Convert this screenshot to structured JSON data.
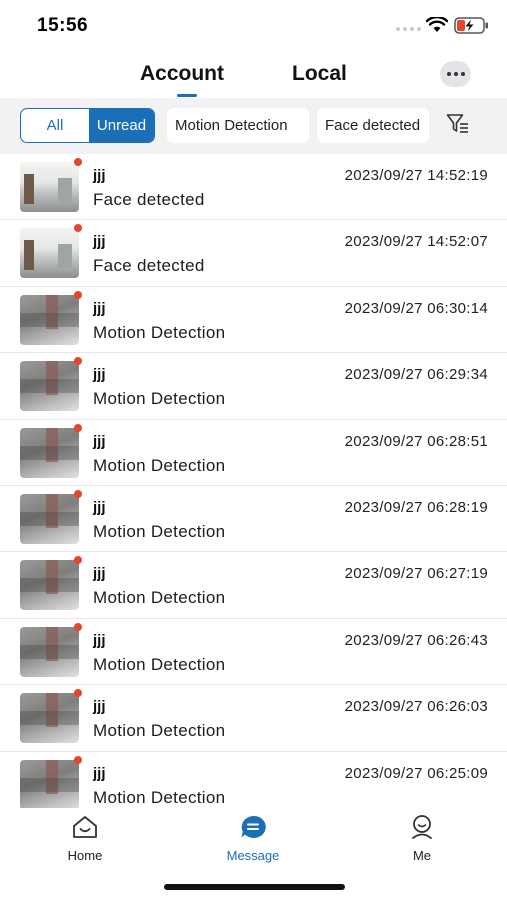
{
  "status_bar": {
    "time": "15:56"
  },
  "header": {
    "tabs": [
      {
        "label": "Account",
        "active": true
      },
      {
        "label": "Local",
        "active": false
      }
    ],
    "more_icon": "ellipsis-icon"
  },
  "filters": {
    "all_label": "All",
    "unread_label": "Unread",
    "selected": "Unread",
    "chips": [
      "Motion Detection",
      "Face detected"
    ],
    "filter_icon": "filter-list-icon"
  },
  "messages": [
    {
      "device": "jjj",
      "type": "Face detected",
      "time": "2023/09/27 14:52:19",
      "thumb": "face",
      "unread": true
    },
    {
      "device": "jjj",
      "type": "Face detected",
      "time": "2023/09/27 14:52:07",
      "thumb": "face",
      "unread": true
    },
    {
      "device": "jjj",
      "type": "Motion Detection",
      "time": "2023/09/27 06:30:14",
      "thumb": "motion",
      "unread": true
    },
    {
      "device": "jjj",
      "type": "Motion Detection",
      "time": "2023/09/27 06:29:34",
      "thumb": "motion",
      "unread": true
    },
    {
      "device": "jjj",
      "type": "Motion Detection",
      "time": "2023/09/27 06:28:51",
      "thumb": "motion",
      "unread": true
    },
    {
      "device": "jjj",
      "type": "Motion Detection",
      "time": "2023/09/27 06:28:19",
      "thumb": "motion",
      "unread": true
    },
    {
      "device": "jjj",
      "type": "Motion Detection",
      "time": "2023/09/27 06:27:19",
      "thumb": "motion",
      "unread": true
    },
    {
      "device": "jjj",
      "type": "Motion Detection",
      "time": "2023/09/27 06:26:43",
      "thumb": "motion",
      "unread": true
    },
    {
      "device": "jjj",
      "type": "Motion Detection",
      "time": "2023/09/27 06:26:03",
      "thumb": "motion",
      "unread": true
    },
    {
      "device": "jjj",
      "type": "Motion Detection",
      "time": "2023/09/27 06:25:09",
      "thumb": "motion",
      "unread": true
    }
  ],
  "tabbar": {
    "items": [
      {
        "label": "Home",
        "icon": "home-icon",
        "active": false
      },
      {
        "label": "Message",
        "icon": "message-icon",
        "active": true
      },
      {
        "label": "Me",
        "icon": "profile-icon",
        "active": false
      }
    ]
  },
  "colors": {
    "accent": "#1b6fb8",
    "unread_dot": "#e8452f",
    "filter_bar_bg": "#f2f2f4"
  }
}
